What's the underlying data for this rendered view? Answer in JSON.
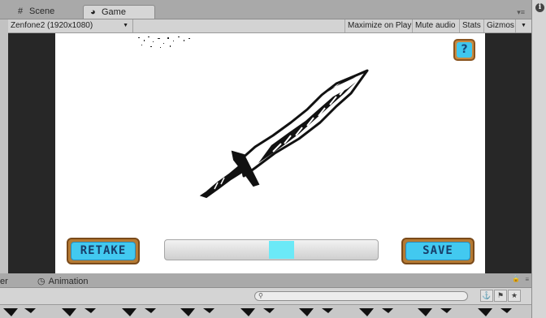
{
  "tabs": {
    "scene_icon": "hash-icon",
    "scene_label": "Scene",
    "game_icon": "pacman-icon",
    "game_label": "Game",
    "menu_icon": "panel-menu-icon"
  },
  "toolbar": {
    "resolution": "Zenfone2 (1920x1080)",
    "maximize_on_play": "Maximize on Play",
    "mute_audio": "Mute audio",
    "stats": "Stats",
    "gizmos": "Gizmos"
  },
  "game": {
    "help_label": "?",
    "retake_label": "RETAKE",
    "save_label": "SAVE",
    "progress_fraction": 0.12,
    "progress_offset_fraction": 0.49,
    "colors": {
      "button_face": "#42c9f0",
      "button_frame": "#b57a33",
      "progress_fill": "#6be9f7"
    }
  },
  "bottom_panel": {
    "partial_tab_label": "er",
    "animation_icon": "clock-icon",
    "animation_label": "Animation",
    "search_icon": "search-icon"
  },
  "inspector": {
    "info_icon": "info-icon"
  }
}
